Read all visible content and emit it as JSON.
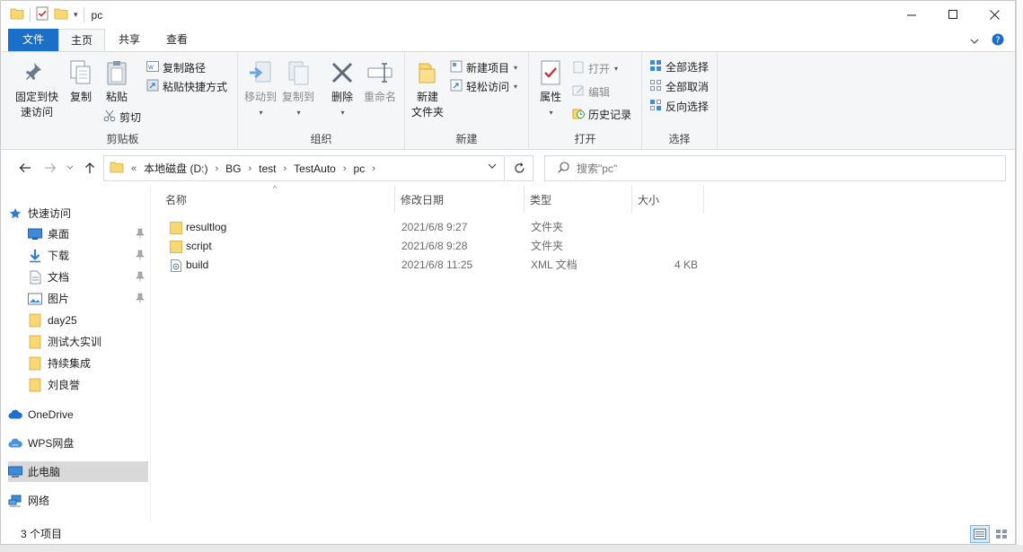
{
  "window": {
    "title": "pc",
    "minimize_glyph": "—",
    "maximize_glyph": "☐",
    "close_glyph": "✕"
  },
  "ribbon_tabs": {
    "file": "文件",
    "home": "主页",
    "share": "共享",
    "view": "查看"
  },
  "ribbon": {
    "clipboard": {
      "label": "剪贴板",
      "pin_quick_access": [
        "固定到快",
        "速访问"
      ],
      "copy": "复制",
      "paste": "粘贴",
      "copy_path": "复制路径",
      "paste_shortcut": "粘贴快捷方式",
      "cut": "剪切"
    },
    "organize": {
      "label": "组织",
      "move_to": "移动到",
      "copy_to": "复制到",
      "delete": "删除",
      "rename": "重命名"
    },
    "new": {
      "label": "新建",
      "new_folder": [
        "新建",
        "文件夹"
      ],
      "new_item": "新建项目",
      "easy_access": "轻松访问"
    },
    "open": {
      "label": "打开",
      "properties": "属性",
      "open": "打开",
      "edit": "编辑",
      "history": "历史记录"
    },
    "select": {
      "label": "选择",
      "select_all": "全部选择",
      "select_none": "全部取消",
      "invert": "反向选择"
    }
  },
  "address": {
    "overflow": "«",
    "crumbs": [
      "本地磁盘 (D:)",
      "BG",
      "test",
      "TestAuto",
      "pc"
    ]
  },
  "search": {
    "placeholder": "搜索\"pc\""
  },
  "sidebar": {
    "quick_access": "快速访问",
    "items": [
      {
        "label": "桌面",
        "icon": "desktop-icon",
        "pinned": true
      },
      {
        "label": "下载",
        "icon": "download-icon",
        "pinned": true
      },
      {
        "label": "文档",
        "icon": "document-icon",
        "pinned": true
      },
      {
        "label": "图片",
        "icon": "picture-icon",
        "pinned": true
      },
      {
        "label": "day25",
        "icon": "folder-icon",
        "pinned": false
      },
      {
        "label": "测试大实训",
        "icon": "folder-icon",
        "pinned": false
      },
      {
        "label": "持续集成",
        "icon": "folder-icon",
        "pinned": false
      },
      {
        "label": "刘良誉",
        "icon": "folder-icon",
        "pinned": false
      }
    ],
    "onedrive": "OneDrive",
    "wps": "WPS网盘",
    "this_pc": "此电脑",
    "network": "网络"
  },
  "columns": {
    "name": "名称",
    "modified": "修改日期",
    "type": "类型",
    "size": "大小"
  },
  "files": [
    {
      "name": "resultlog",
      "modified": "2021/6/8 9:27",
      "type": "文件夹",
      "size": "",
      "icon": "folder-icon"
    },
    {
      "name": "script",
      "modified": "2021/6/8 9:28",
      "type": "文件夹",
      "size": "",
      "icon": "folder-icon"
    },
    {
      "name": "build",
      "modified": "2021/6/8 11:25",
      "type": "XML 文档",
      "size": "4 KB",
      "icon": "xml-file-icon"
    }
  ],
  "status": {
    "item_count": "3 个项目"
  },
  "colors": {
    "accent": "#1a6fc9",
    "folder": "#f8d775",
    "ribbon_bg": "#f5f6f7",
    "selected_nav": "#d9d9d9"
  }
}
